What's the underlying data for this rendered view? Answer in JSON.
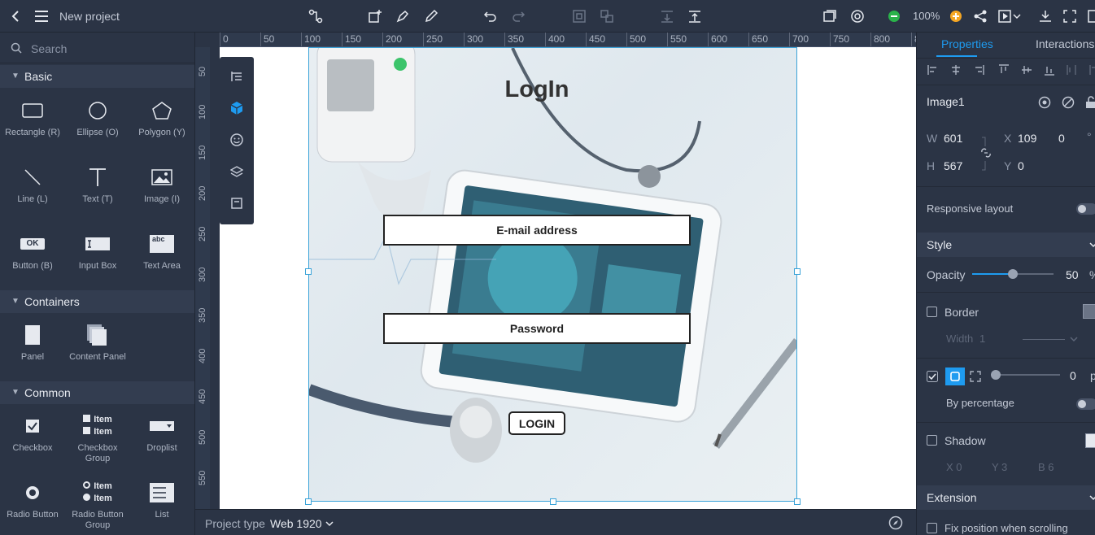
{
  "app": {
    "title": "New project",
    "zoom": "100%"
  },
  "search": {
    "placeholder": "Search"
  },
  "sections": {
    "basic": "Basic",
    "containers": "Containers",
    "common": "Common"
  },
  "components": {
    "basic": [
      "Rectangle (R)",
      "Ellipse (O)",
      "Polygon (Y)",
      "Line (L)",
      "Text (T)",
      "Image (I)",
      "Button (B)",
      "Input Box",
      "Text Area"
    ],
    "containers": [
      "Panel",
      "Content Panel"
    ],
    "common": [
      "Checkbox",
      "Checkbox Group",
      "Droplist",
      "Radio Button",
      "Radio Button Group",
      "List"
    ],
    "button_glyph": "OK",
    "textarea_glyph": "abc",
    "item_label": "Item"
  },
  "ruler": {
    "top": [
      "0",
      "50",
      "100",
      "150",
      "200",
      "250",
      "300",
      "350",
      "400",
      "450",
      "500",
      "550",
      "600",
      "650",
      "700",
      "750",
      "800",
      "8"
    ],
    "left": [
      "50",
      "100",
      "150",
      "200",
      "250",
      "300",
      "350",
      "400",
      "450",
      "500",
      "550"
    ]
  },
  "canvas": {
    "title": "LogIn",
    "email_placeholder": "E-mail address",
    "password_placeholder": "Password",
    "login_button": "LOGIN"
  },
  "bottom": {
    "project_type_label": "Project type",
    "project_type_value": "Web 1920"
  },
  "properties": {
    "tab_properties": "Properties",
    "tab_interactions": "Interactions",
    "element_name": "Image1",
    "w_label": "W",
    "w_value": "601",
    "h_label": "H",
    "h_value": "567",
    "x_label": "X",
    "x_value": "109",
    "y_label": "Y",
    "y_value": "0",
    "rotation": "0",
    "degree": "°",
    "responsive_layout": "Responsive layout",
    "style": "Style",
    "opacity_label": "Opacity",
    "opacity_value": "50",
    "opacity_unit": "%",
    "opacity_level": 0.5,
    "border_label": "Border",
    "width_label": "Width",
    "width_value": "1",
    "radius_value": "0",
    "radius_unit": "p",
    "by_percentage": "By percentage",
    "shadow_label": "Shadow",
    "shadow_x": "X 0",
    "shadow_y": "Y 3",
    "shadow_b": "B 6",
    "extension": "Extension",
    "fix_position": "Fix position when scrolling"
  },
  "colors": {
    "accent": "#1e9bf0",
    "selection": "#3aa3d8",
    "panel": "#2b3445",
    "green": "#2ab34a",
    "orange": "#f5a623"
  }
}
